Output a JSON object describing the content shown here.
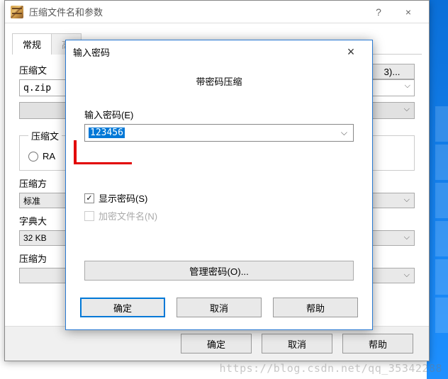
{
  "mainWindow": {
    "title": "压缩文件名和参数",
    "tabs": [
      "常规",
      "高"
    ],
    "fileLabel": "压缩文",
    "fileName": "q.zip",
    "browse": "3)...",
    "formatGroupLabel": "压缩文",
    "formatRadio": "RA",
    "methodLabel": "压缩方",
    "methodValue": "标准",
    "dictLabel": "字典大",
    "dictValue": "32 KB",
    "resultLabel": "压缩为",
    "buttons": {
      "ok": "确定",
      "cancel": "取消",
      "help": "帮助"
    }
  },
  "passwordDialog": {
    "title": "输入密码",
    "heading": "带密码压缩",
    "passwordLabel": "输入密码(E)",
    "passwordValue": "123456",
    "showPassword": "显示密码(S)",
    "encryptNames": "加密文件名(N)",
    "managePasswords": "管理密码(O)...",
    "buttons": {
      "ok": "确定",
      "cancel": "取消",
      "help": "帮助"
    }
  },
  "watermark": "https://blog.csdn.net/qq_35342288"
}
